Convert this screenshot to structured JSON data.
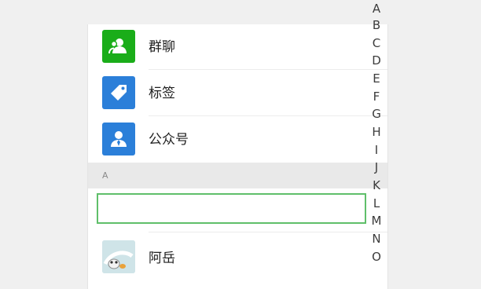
{
  "contacts_list": {
    "special_entries": [
      {
        "label": "群聊",
        "icon": "group-chat-icon",
        "color": "#1aad19"
      },
      {
        "label": "标签",
        "icon": "tag-icon",
        "color": "#2b7fd9"
      },
      {
        "label": "公众号",
        "icon": "official-account-icon",
        "color": "#2b7fd9"
      }
    ],
    "section_header": "A",
    "contacts": [
      {
        "label": "",
        "highlighted": true,
        "highlight_color": "#5fbf6a"
      },
      {
        "label": "阿岳",
        "avatar": "cartoon-avatar-icon"
      }
    ]
  },
  "index_bar": {
    "letters": [
      "A",
      "B",
      "C",
      "D",
      "E",
      "F",
      "G",
      "H",
      "I",
      "J",
      "K",
      "L",
      "M",
      "N",
      "O"
    ]
  }
}
